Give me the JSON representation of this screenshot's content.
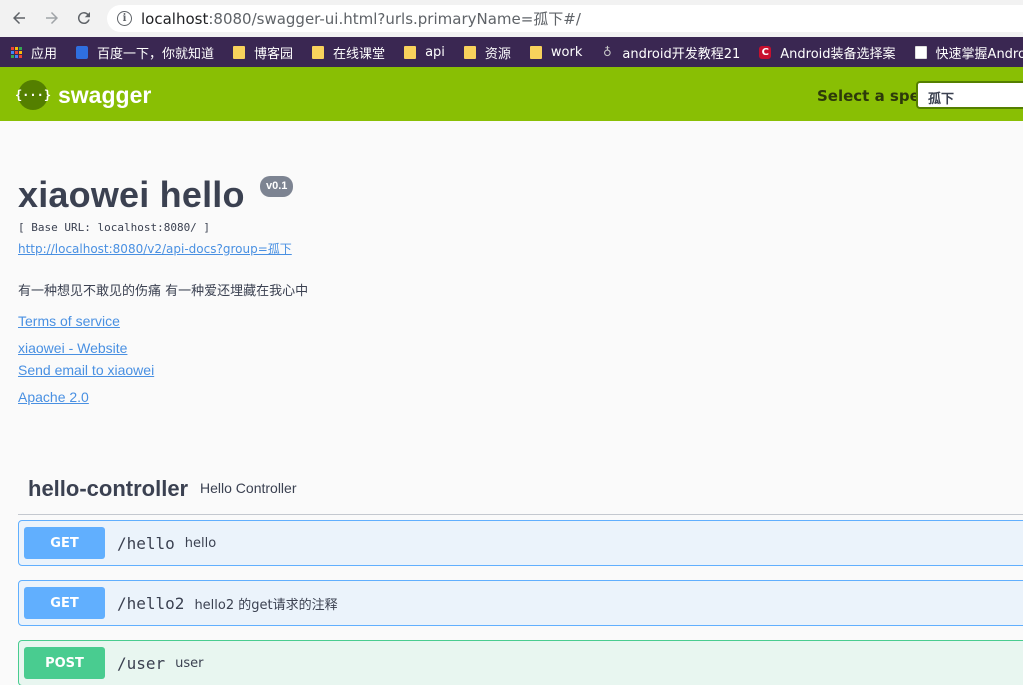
{
  "browser": {
    "url_host": "localhost",
    "url_rest": ":8080/swagger-ui.html?urls.primaryName=孤下#/",
    "bookmarks": [
      {
        "label": "应用",
        "icon": "apps-grid-icon"
      },
      {
        "label": "百度一下，你就知道",
        "icon": "baidu-paw-icon"
      },
      {
        "label": "博客园",
        "icon": "folder-icon"
      },
      {
        "label": "在线课堂",
        "icon": "folder-icon"
      },
      {
        "label": "api",
        "icon": "folder-icon"
      },
      {
        "label": "资源",
        "icon": "folder-icon"
      },
      {
        "label": "work",
        "icon": "folder-icon"
      },
      {
        "label": "android开发教程21",
        "icon": "android-icon"
      },
      {
        "label": "Android装备选择案",
        "icon": "csdn-icon"
      },
      {
        "label": "快速掌握Android开发",
        "icon": "page-icon"
      }
    ]
  },
  "topbar": {
    "logo_text": "swagger",
    "logo_glyph": "{···}",
    "spec_label": "Select a spec",
    "spec_value": "孤下",
    "brand_color": "#89bf04"
  },
  "info": {
    "title": "xiaowei hello",
    "version": "v0.1",
    "base_url": "[ Base URL: localhost:8080/ ]",
    "api_docs_url": "http://localhost:8080/v2/api-docs?group=孤下",
    "description": "有一种想见不敢见的伤痛 有一种爱还埋藏在我心中",
    "terms": "Terms of service",
    "website": "xiaowei - Website",
    "email": "Send email to xiaowei",
    "license": "Apache 2.0"
  },
  "tag": {
    "name": "hello-controller",
    "description": "Hello Controller"
  },
  "operations": [
    {
      "method": "GET",
      "path": "/hello",
      "summary": "hello",
      "color": "#61affe"
    },
    {
      "method": "GET",
      "path": "/hello2",
      "summary": "hello2 的get请求的注释",
      "color": "#61affe"
    },
    {
      "method": "POST",
      "path": "/user",
      "summary": "user",
      "color": "#49cc90"
    }
  ]
}
